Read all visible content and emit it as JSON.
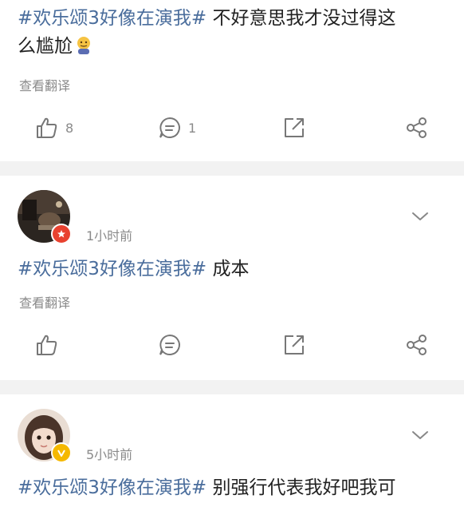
{
  "posts": [
    {
      "tag": "#欢乐颂3好像在演我#",
      "body_line1": " 不好意思我才没过得这",
      "body_line2": "么尴尬",
      "translate": "查看翻译",
      "likes": "8",
      "comments": "1"
    },
    {
      "time": "1小时前",
      "tag": "#欢乐颂3好像在演我#",
      "body": " 成本",
      "translate": "查看翻译"
    },
    {
      "time": "5小时前",
      "tag": "#欢乐颂3好像在演我#",
      "body": " 别强行代表我好吧我可"
    }
  ],
  "colors": {
    "tag": "#4a6d9c",
    "icon": "#777777",
    "separator": "#f2f2f2",
    "badge_red": "#e8412f",
    "badge_gold": "#f5b800"
  }
}
